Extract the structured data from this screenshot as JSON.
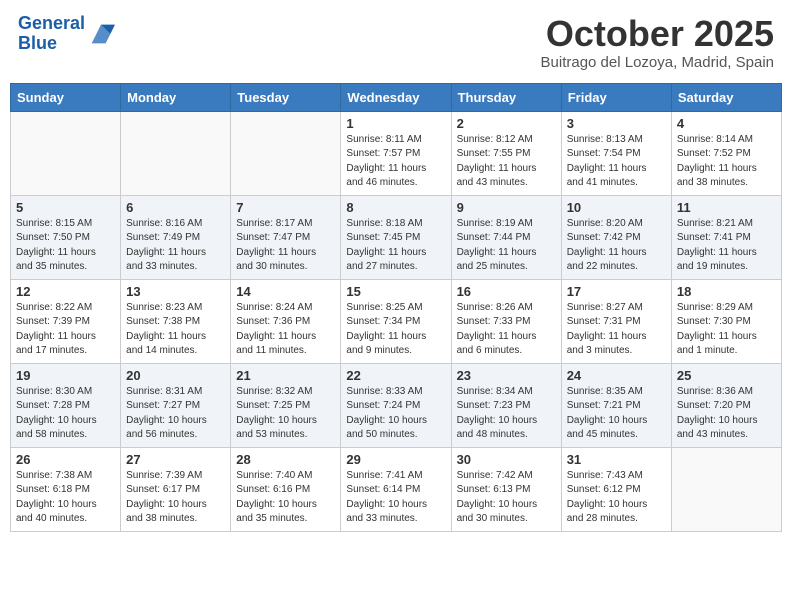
{
  "header": {
    "logo_general": "General",
    "logo_blue": "Blue",
    "month_title": "October 2025",
    "location": "Buitrago del Lozoya, Madrid, Spain"
  },
  "weekdays": [
    "Sunday",
    "Monday",
    "Tuesday",
    "Wednesday",
    "Thursday",
    "Friday",
    "Saturday"
  ],
  "weeks": [
    [
      {
        "day": "",
        "info": ""
      },
      {
        "day": "",
        "info": ""
      },
      {
        "day": "",
        "info": ""
      },
      {
        "day": "1",
        "info": "Sunrise: 8:11 AM\nSunset: 7:57 PM\nDaylight: 11 hours and 46 minutes."
      },
      {
        "day": "2",
        "info": "Sunrise: 8:12 AM\nSunset: 7:55 PM\nDaylight: 11 hours and 43 minutes."
      },
      {
        "day": "3",
        "info": "Sunrise: 8:13 AM\nSunset: 7:54 PM\nDaylight: 11 hours and 41 minutes."
      },
      {
        "day": "4",
        "info": "Sunrise: 8:14 AM\nSunset: 7:52 PM\nDaylight: 11 hours and 38 minutes."
      }
    ],
    [
      {
        "day": "5",
        "info": "Sunrise: 8:15 AM\nSunset: 7:50 PM\nDaylight: 11 hours and 35 minutes."
      },
      {
        "day": "6",
        "info": "Sunrise: 8:16 AM\nSunset: 7:49 PM\nDaylight: 11 hours and 33 minutes."
      },
      {
        "day": "7",
        "info": "Sunrise: 8:17 AM\nSunset: 7:47 PM\nDaylight: 11 hours and 30 minutes."
      },
      {
        "day": "8",
        "info": "Sunrise: 8:18 AM\nSunset: 7:45 PM\nDaylight: 11 hours and 27 minutes."
      },
      {
        "day": "9",
        "info": "Sunrise: 8:19 AM\nSunset: 7:44 PM\nDaylight: 11 hours and 25 minutes."
      },
      {
        "day": "10",
        "info": "Sunrise: 8:20 AM\nSunset: 7:42 PM\nDaylight: 11 hours and 22 minutes."
      },
      {
        "day": "11",
        "info": "Sunrise: 8:21 AM\nSunset: 7:41 PM\nDaylight: 11 hours and 19 minutes."
      }
    ],
    [
      {
        "day": "12",
        "info": "Sunrise: 8:22 AM\nSunset: 7:39 PM\nDaylight: 11 hours and 17 minutes."
      },
      {
        "day": "13",
        "info": "Sunrise: 8:23 AM\nSunset: 7:38 PM\nDaylight: 11 hours and 14 minutes."
      },
      {
        "day": "14",
        "info": "Sunrise: 8:24 AM\nSunset: 7:36 PM\nDaylight: 11 hours and 11 minutes."
      },
      {
        "day": "15",
        "info": "Sunrise: 8:25 AM\nSunset: 7:34 PM\nDaylight: 11 hours and 9 minutes."
      },
      {
        "day": "16",
        "info": "Sunrise: 8:26 AM\nSunset: 7:33 PM\nDaylight: 11 hours and 6 minutes."
      },
      {
        "day": "17",
        "info": "Sunrise: 8:27 AM\nSunset: 7:31 PM\nDaylight: 11 hours and 3 minutes."
      },
      {
        "day": "18",
        "info": "Sunrise: 8:29 AM\nSunset: 7:30 PM\nDaylight: 11 hours and 1 minute."
      }
    ],
    [
      {
        "day": "19",
        "info": "Sunrise: 8:30 AM\nSunset: 7:28 PM\nDaylight: 10 hours and 58 minutes."
      },
      {
        "day": "20",
        "info": "Sunrise: 8:31 AM\nSunset: 7:27 PM\nDaylight: 10 hours and 56 minutes."
      },
      {
        "day": "21",
        "info": "Sunrise: 8:32 AM\nSunset: 7:25 PM\nDaylight: 10 hours and 53 minutes."
      },
      {
        "day": "22",
        "info": "Sunrise: 8:33 AM\nSunset: 7:24 PM\nDaylight: 10 hours and 50 minutes."
      },
      {
        "day": "23",
        "info": "Sunrise: 8:34 AM\nSunset: 7:23 PM\nDaylight: 10 hours and 48 minutes."
      },
      {
        "day": "24",
        "info": "Sunrise: 8:35 AM\nSunset: 7:21 PM\nDaylight: 10 hours and 45 minutes."
      },
      {
        "day": "25",
        "info": "Sunrise: 8:36 AM\nSunset: 7:20 PM\nDaylight: 10 hours and 43 minutes."
      }
    ],
    [
      {
        "day": "26",
        "info": "Sunrise: 7:38 AM\nSunset: 6:18 PM\nDaylight: 10 hours and 40 minutes."
      },
      {
        "day": "27",
        "info": "Sunrise: 7:39 AM\nSunset: 6:17 PM\nDaylight: 10 hours and 38 minutes."
      },
      {
        "day": "28",
        "info": "Sunrise: 7:40 AM\nSunset: 6:16 PM\nDaylight: 10 hours and 35 minutes."
      },
      {
        "day": "29",
        "info": "Sunrise: 7:41 AM\nSunset: 6:14 PM\nDaylight: 10 hours and 33 minutes."
      },
      {
        "day": "30",
        "info": "Sunrise: 7:42 AM\nSunset: 6:13 PM\nDaylight: 10 hours and 30 minutes."
      },
      {
        "day": "31",
        "info": "Sunrise: 7:43 AM\nSunset: 6:12 PM\nDaylight: 10 hours and 28 minutes."
      },
      {
        "day": "",
        "info": ""
      }
    ]
  ]
}
